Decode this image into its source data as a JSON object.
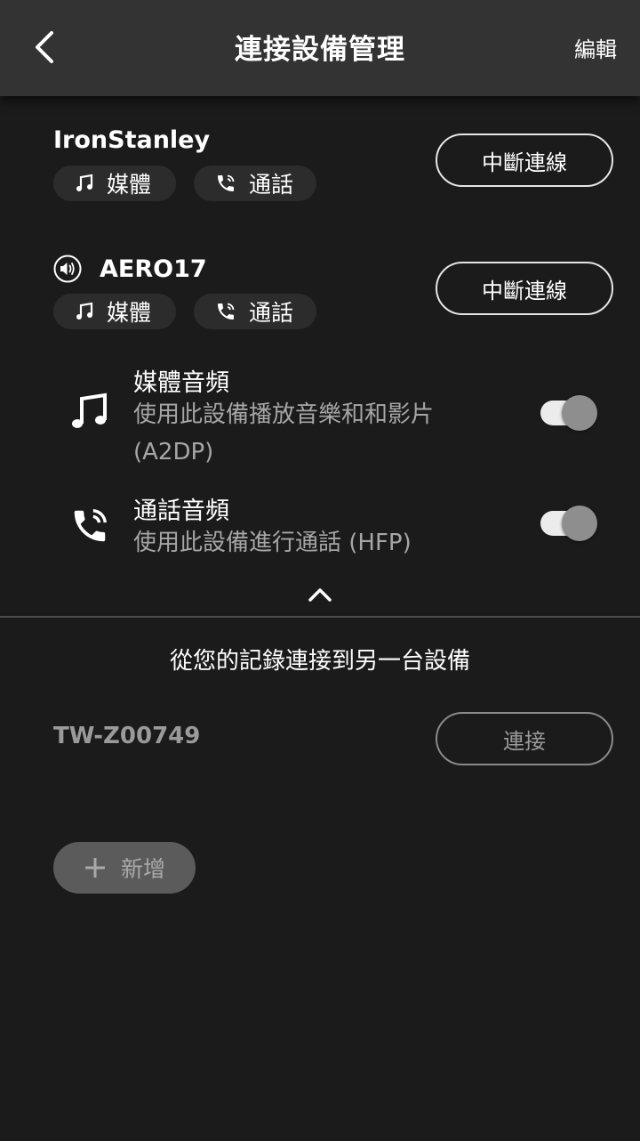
{
  "header": {
    "title": "連接設備管理",
    "edit_label": "編輯"
  },
  "devices": [
    {
      "name": "IronStanley",
      "chips": {
        "media": "媒體",
        "call": "通話"
      },
      "disconnect_label": "中斷連線"
    },
    {
      "name": "AERO17",
      "chips": {
        "media": "媒體",
        "call": "通話"
      },
      "disconnect_label": "中斷連線",
      "profiles": {
        "media": {
          "title": "媒體音頻",
          "desc": "使用此設備播放音樂和和影片 (A2DP)",
          "enabled": true
        },
        "call": {
          "title": "通話音頻",
          "desc": "使用此設備進行通話 (HFP)",
          "enabled": true
        }
      }
    }
  ],
  "history": {
    "title": "從您的記錄連接到另一台設備",
    "items": [
      {
        "name": "TW-Z00749",
        "connect_label": "連接"
      }
    ]
  },
  "add_label": "新增",
  "colors": {
    "background": "#1b1b1b",
    "header": "#333333",
    "chip": "#2c2c2c",
    "muted": "#a6a6a6"
  }
}
